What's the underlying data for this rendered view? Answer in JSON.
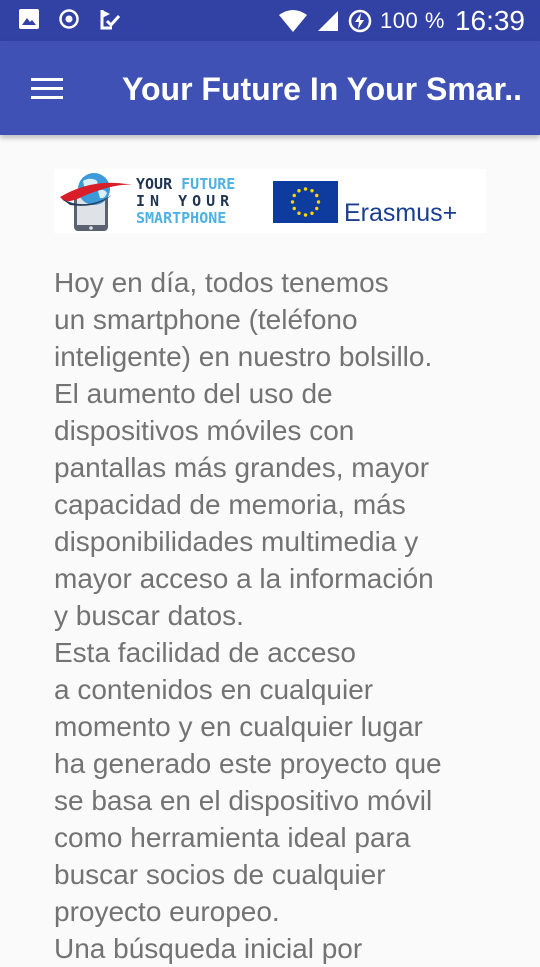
{
  "status_bar": {
    "left_icons": [
      "image-icon",
      "record-icon",
      "check-clipboard-icon"
    ],
    "right_icons": [
      "wifi-icon",
      "signal-icon",
      "battery-charging-icon"
    ],
    "battery": "100 %",
    "time": "16:39"
  },
  "app_bar": {
    "menu_icon": "hamburger-menu-icon",
    "title": "Your Future In Your Smar..."
  },
  "logos": {
    "project": {
      "line1a": "YOUR ",
      "line1b": "FUTURE",
      "line2": "IN YOUR",
      "line3": "SMARTPHONE"
    },
    "erasmus": "Erasmus+"
  },
  "colors": {
    "status_bar": "#3241a4",
    "app_bar": "#3f51b5",
    "background": "#fafafa",
    "body_text": "#737373",
    "eu_flag": "#0e3b9e",
    "eu_stars": "#ffd700"
  },
  "content": {
    "paragraphs": [
      "Hoy en día, todos tenemos\nun smartphone (teléfono\ninteligente) en nuestro bolsillo.\nEl aumento del uso de\ndispositivos móviles con\npantallas más grandes, mayor\ncapacidad de memoria, más\ndisponibilidades multimedia y\nmayor acceso a la información\ny buscar datos.",
      "Esta facilidad de acceso\na contenidos en cualquier\nmomento y en cualquier lugar\nha generado este proyecto que\nse basa en el dispositivo móvil\ncomo herramienta ideal para\nbuscar socios de cualquier\nproyecto europeo.",
      "Una búsqueda inicial por"
    ]
  }
}
